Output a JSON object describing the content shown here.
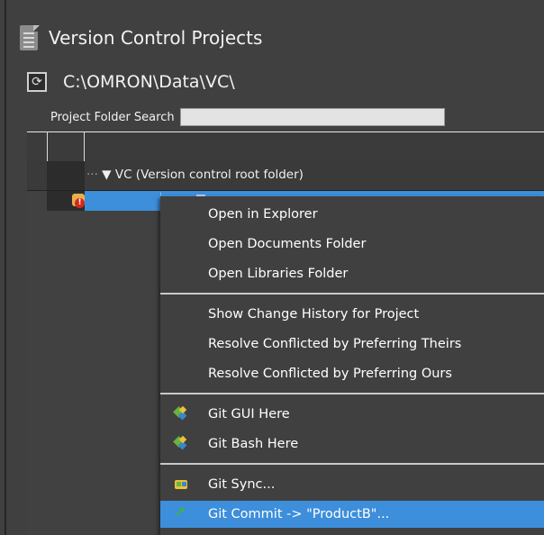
{
  "window": {
    "title": "Version Control Projects",
    "path": "C:\\OMRON\\Data\\VC\\"
  },
  "search": {
    "label": "Project Folder Search",
    "value": "",
    "placeholder": ""
  },
  "tree": {
    "root_label": "VC (Version control root folder)",
    "root_expander": "▼",
    "tree_prefix": "···"
  },
  "context_menu": {
    "items": [
      {
        "label": "Open in Explorer"
      },
      {
        "label": "Open Documents Folder"
      },
      {
        "label": "Open Libraries Folder"
      },
      {
        "label": "Show Change History for Project"
      },
      {
        "label": "Resolve Conflicted by Preferring Theirs"
      },
      {
        "label": "Resolve Conflicted by Preferring Ours"
      },
      {
        "label": "Git GUI Here",
        "icon": "git-gui-icon"
      },
      {
        "label": "Git Bash Here",
        "icon": "git-bash-icon"
      },
      {
        "label": "Git Sync...",
        "icon": "git-sync-icon"
      },
      {
        "label": "Git Commit -> \"ProductB\"...",
        "icon": "git-commit-arrow-icon"
      }
    ],
    "highlighted_item": "Git Commit -> \"ProductB\"..."
  },
  "colors": {
    "background": "#404040",
    "selection": "#3d8edb",
    "text": "#ffffff"
  }
}
